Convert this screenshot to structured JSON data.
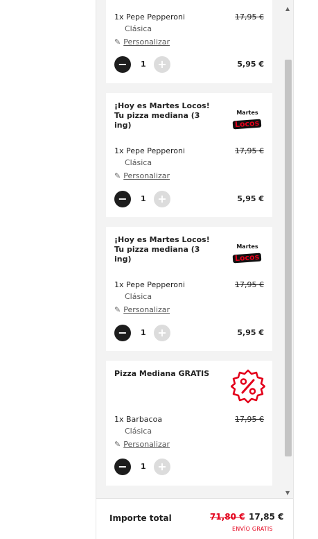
{
  "cart": {
    "cards": [
      {
        "promo_title": "",
        "item": {
          "qty_name": "1x Pepe Pepperoni",
          "variant": "Clásica",
          "old_price": "17,95 €"
        },
        "personalize_label": "Personalizar",
        "quantity": "1",
        "line_price": "5,95 €"
      },
      {
        "promo_title": "¡Hoy es Martes Locos! Tu pizza mediana (3 ing)",
        "promo_logo": {
          "line1": "Martes",
          "line2": "Locos"
        },
        "item": {
          "qty_name": "1x Pepe Pepperoni",
          "variant": "Clásica",
          "old_price": "17,95 €"
        },
        "personalize_label": "Personalizar",
        "quantity": "1",
        "line_price": "5,95 €"
      },
      {
        "promo_title": "¡Hoy es Martes Locos! Tu pizza mediana (3 ing)",
        "promo_logo": {
          "line1": "Martes",
          "line2": "Locos"
        },
        "item": {
          "qty_name": "1x Pepe Pepperoni",
          "variant": "Clásica",
          "old_price": "17,95 €"
        },
        "personalize_label": "Personalizar",
        "quantity": "1",
        "line_price": "5,95 €"
      },
      {
        "promo_title": "Pizza Mediana GRATIS",
        "promo_icon": "discount-percent-badge-icon",
        "item": {
          "qty_name": "1x Barbacoa",
          "variant": "Clásica",
          "old_price": "17,95 €"
        },
        "personalize_label": "Personalizar",
        "quantity": "1",
        "line_price": ""
      }
    ]
  },
  "footer": {
    "total_label": "Importe total",
    "old_total": "71,80 €",
    "new_total": "17,85 €",
    "delivery_note": "ENVÍO GRATIS"
  },
  "colors": {
    "accent": "#e3001b",
    "minus_button": "#1d1d1d",
    "plus_button_disabled": "#dcdcdc"
  }
}
